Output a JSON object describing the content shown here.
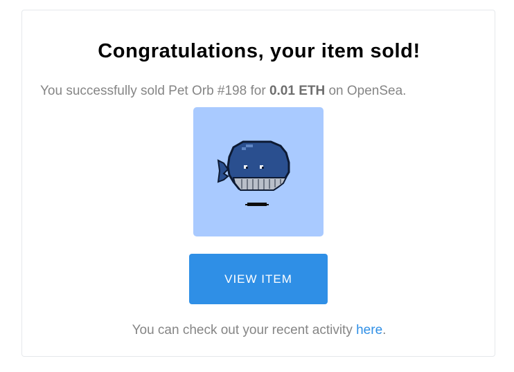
{
  "email": {
    "title": "Congratulations, your item sold!",
    "message": {
      "prefix": "You successfully sold Pet Orb #198 for ",
      "price": "0.01 ETH",
      "suffix": " on OpenSea."
    },
    "item": {
      "image_icon": "pixel-whale-icon",
      "background_color": "#a9caff"
    },
    "button_label": "VIEW ITEM",
    "button_color": "#2f8fe6",
    "footer": {
      "prefix": "You can check out your recent activity ",
      "link_text": "here",
      "suffix": "."
    }
  }
}
